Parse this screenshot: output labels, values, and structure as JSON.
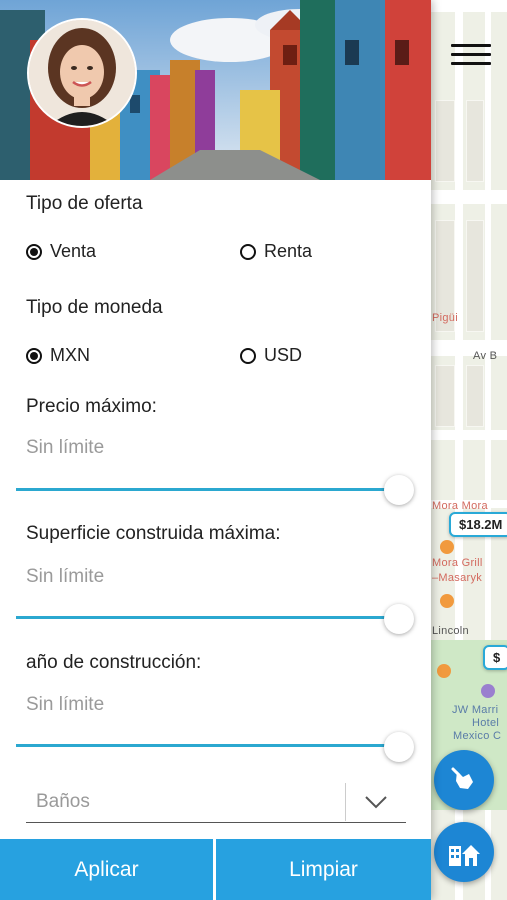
{
  "map": {
    "labels": {
      "pigui": "Pigüi",
      "av_b": "Av B",
      "mora_mora": "Mora Mora",
      "mora_grill": "Mora Grill",
      "masaryk": "–Masaryk",
      "lincoln": "Lincoln",
      "jw_1": "JW Marri",
      "jw_2": "Hotel",
      "jw_3": "Mexico C"
    },
    "price_tags": [
      "$18.2M",
      "$"
    ],
    "accent_color": "#29a9d7"
  },
  "header": {
    "menu_icon": "hamburger-icon"
  },
  "filters": {
    "offer_type": {
      "label": "Tipo de oferta",
      "options": [
        "Venta",
        "Renta"
      ],
      "selected": "Venta"
    },
    "currency": {
      "label": "Tipo de moneda",
      "options": [
        "MXN",
        "USD"
      ],
      "selected": "MXN"
    },
    "max_price": {
      "label": "Precio máximo:",
      "value": "Sin límite",
      "slider_fraction": 1.0
    },
    "max_built_area": {
      "label": "Superficie construida máxima:",
      "value": "Sin límite",
      "slider_fraction": 1.0
    },
    "build_year": {
      "label": "año de construcción:",
      "value": "Sin límite",
      "slider_fraction": 1.0
    },
    "bathrooms": {
      "placeholder": "Baños"
    }
  },
  "actions": {
    "apply": "Aplicar",
    "clear": "Limpiar",
    "button_color": "#27a1e0"
  }
}
